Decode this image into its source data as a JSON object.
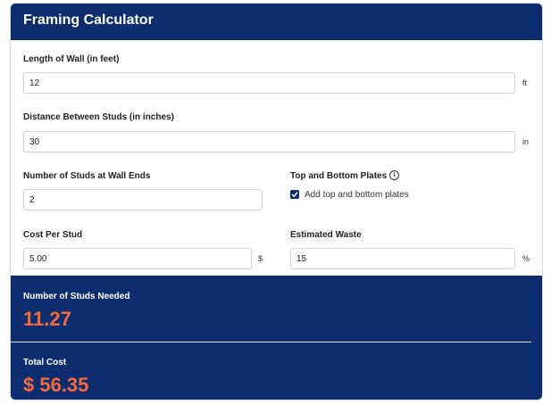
{
  "header": {
    "title": "Framing Calculator"
  },
  "fields": {
    "wall_length": {
      "label": "Length of Wall (in feet)",
      "value": "12",
      "unit": "ft"
    },
    "stud_distance": {
      "label": "Distance Between Studs (in inches)",
      "value": "30",
      "unit": "in"
    },
    "studs_at_ends": {
      "label": "Number of Studs at Wall Ends",
      "value": "2"
    },
    "plates": {
      "label": "Top and Bottom Plates",
      "info_icon": "info-icon",
      "checkbox_label": "Add top and bottom plates",
      "checked": true
    },
    "cost_per_stud": {
      "label": "Cost Per Stud",
      "value": "5.00",
      "unit": "$"
    },
    "waste": {
      "label": "Estimated Waste",
      "value": "15",
      "unit": "%"
    }
  },
  "results": {
    "studs_needed": {
      "label": "Number of Studs Needed",
      "value": "11.27"
    },
    "total_cost": {
      "label": "Total Cost",
      "value": "$ 56.35"
    }
  },
  "colors": {
    "header_bg": "#0d2d6e",
    "result_value": "#f26a3d"
  }
}
